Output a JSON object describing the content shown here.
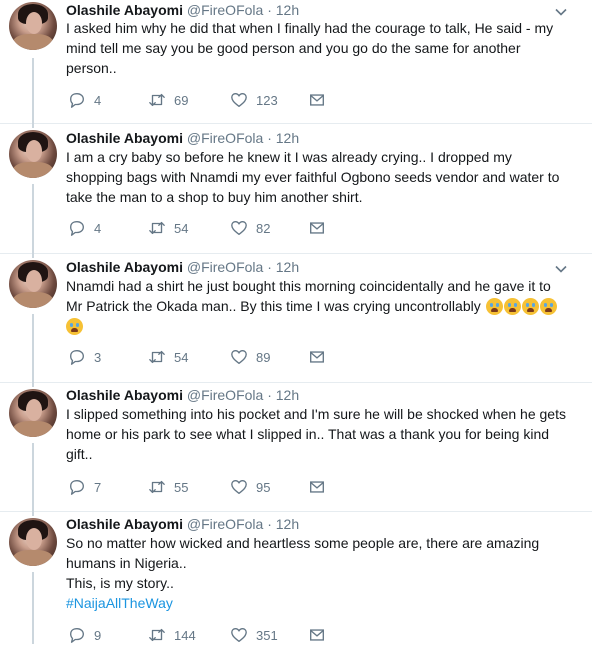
{
  "tweets": [
    {
      "name": "Olashile Abayomi",
      "handle": "@FireOFola",
      "sep": "·",
      "time": "12h",
      "lines": [
        "I asked him why he did that when I finally had the courage to talk,  He said - my",
        "mind tell me say you be good person and you go do the same for another",
        "person.."
      ],
      "replies": "4",
      "retweets": "69",
      "likes": "123"
    },
    {
      "name": "Olashile Abayomi",
      "handle": "@FireOFola",
      "sep": "·",
      "time": "12h",
      "lines": [
        "I am a cry baby so before he knew it I was already crying..  I dropped my",
        "shopping bags with Nnamdi my ever faithful Ogbono seeds vendor and water to",
        "take the man to a shop to buy him another shirt."
      ],
      "replies": "4",
      "retweets": "54",
      "likes": "82"
    },
    {
      "name": "Olashile Abayomi",
      "handle": "@FireOFola",
      "sep": "·",
      "time": "12h",
      "lines": [
        "Nnamdi had a shirt he just bought this morning coincidentally and he gave it to",
        "Mr Patrick the Okada man..  By this time I was crying uncontrollably"
      ],
      "emoji_icon": "loudly-crying-face-emoji",
      "replies": "3",
      "retweets": "54",
      "likes": "89"
    },
    {
      "name": "Olashile Abayomi",
      "handle": "@FireOFola",
      "sep": "·",
      "time": "12h",
      "lines": [
        "I slipped something into his pocket and I'm sure he will be shocked when he gets",
        "home or his park to see what I slipped in..  That was a thank you for being kind",
        "gift.."
      ],
      "replies": "7",
      "retweets": "55",
      "likes": "95"
    },
    {
      "name": "Olashile Abayomi",
      "handle": "@FireOFola",
      "sep": "·",
      "time": "12h",
      "lines": [
        "So no matter how wicked and heartless some people are,  there are amazing",
        "humans in Nigeria..",
        "This,  is my story.."
      ],
      "hashtag": "#NaijaAllTheWay",
      "replies": "9",
      "retweets": "144",
      "likes": "351"
    }
  ],
  "colors": {
    "text": "#14171a",
    "secondary": "#657786",
    "link": "#1b95e0",
    "thread": "#ccd6dd",
    "divider": "#e6ecf0"
  }
}
